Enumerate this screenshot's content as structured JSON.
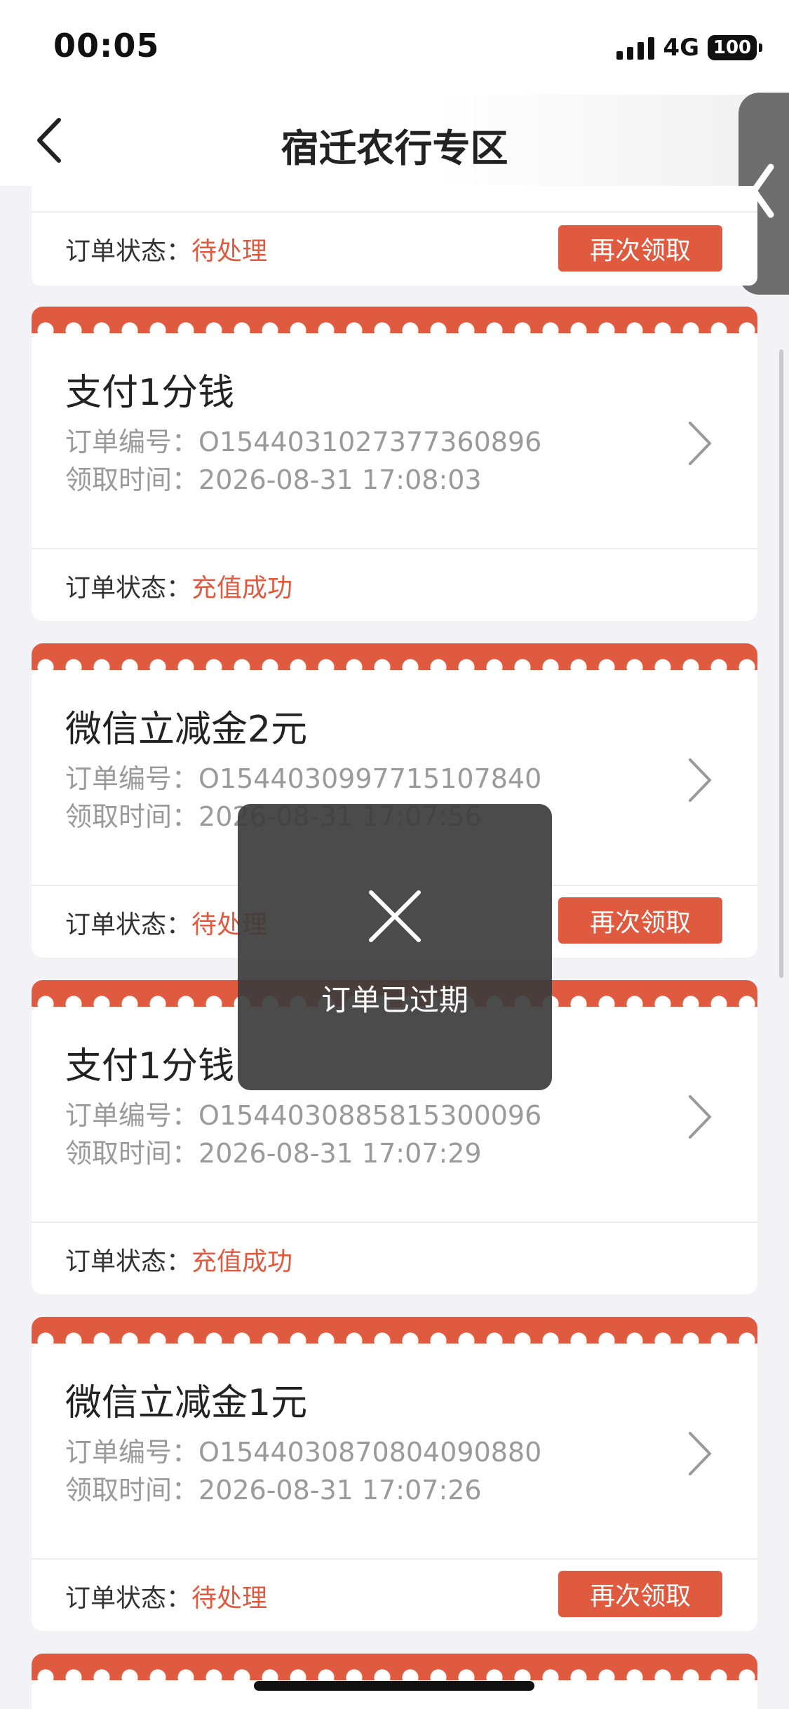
{
  "status_bar": {
    "time": "00:05",
    "network": "4G",
    "battery": "100"
  },
  "nav": {
    "title": "宿迁农行专区"
  },
  "status_label": "订单状态：",
  "order_no_label": "订单编号：",
  "receive_time_label": "领取时间：",
  "retry_label": "再次领取",
  "partial_card": {
    "status": "待处理"
  },
  "cards": [
    {
      "title": "支付1分钱",
      "order_no": "O1544031027377360896",
      "time": "2026-08-31 17:08:03",
      "status": "充值成功"
    },
    {
      "title": "微信立减金2元",
      "order_no": "O1544030997715107840",
      "time": "2026-08-31 17:07:56",
      "status": "待处理"
    },
    {
      "title": "支付1分钱",
      "order_no": "O1544030885815300096",
      "time": "2026-08-31 17:07:29",
      "status": "充值成功"
    },
    {
      "title": "微信立减金1元",
      "order_no": "O1544030870804090880",
      "time": "2026-08-31 17:07:26",
      "status": "待处理"
    }
  ],
  "toast": {
    "message": "订单已过期"
  }
}
